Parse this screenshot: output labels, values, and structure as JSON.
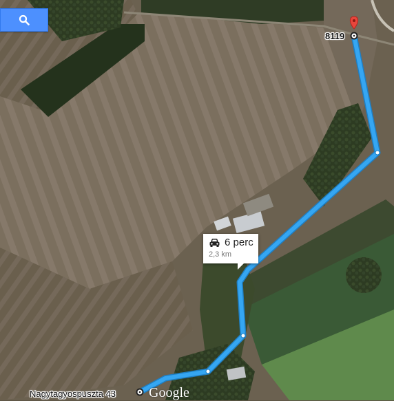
{
  "search": {
    "icon": "search-icon"
  },
  "destination": {
    "label": "8119",
    "icon": "red-pin-icon"
  },
  "origin": {
    "label": "Nagytagyospuszta 43"
  },
  "route": {
    "time": "6 perc",
    "distance": "2,3 km",
    "mode_icon": "car-icon"
  },
  "attribution": {
    "logo": "Google"
  },
  "colors": {
    "route": "#35a6f2",
    "search_button": "#4d90fe",
    "pin": "#e8453c"
  }
}
